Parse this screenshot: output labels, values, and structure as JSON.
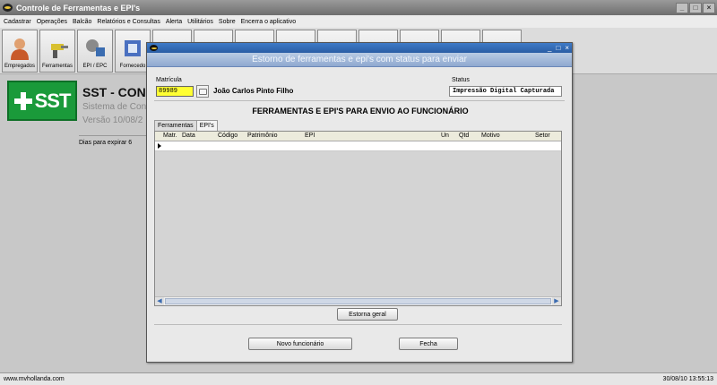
{
  "window": {
    "title": "Controle de Ferramentas e EPI's",
    "controls": {
      "minimize": "_",
      "maximize": "□",
      "close": "×"
    }
  },
  "menu": [
    "Cadastrar",
    "Operações",
    "Balcão",
    "Relatórios e Consultas",
    "Alerta",
    "Utilitários",
    "Sobre",
    "Encerra o aplicativo"
  ],
  "toolbar": {
    "empregados": "Empregados",
    "ferramentas": "Ferramentas",
    "epi_epc": "EPI / EPC",
    "fornecedores": "Fornecedo"
  },
  "background": {
    "logo_text": "SST",
    "app_title": "SST - CONS",
    "app_subtitle": "Sistema de Con",
    "version": "Versão 10/08/2",
    "expiry": "Dias para expirar 6"
  },
  "dialog": {
    "banner": "Estorno de ferramentas e epi's com status para enviar",
    "controls": {
      "minimize": "_",
      "maximize": "□",
      "close": "×"
    },
    "matricula_label": "Matrícula",
    "matricula_value": "89989",
    "employee_name": "João Carlos Pinto Filho",
    "status_label": "Status",
    "status_value": "Impressão Digital Capturada",
    "section_heading": "FERRAMENTAS E EPI'S PARA ENVIO AO FUNCIONÁRIO",
    "tabs": [
      "Ferramentas",
      "EPI's"
    ],
    "grid_columns": {
      "matr": "Matr.",
      "data": "Data",
      "codigo": "Código",
      "patrimonio": "Patrimônio",
      "epi": "EPI",
      "un": "Un",
      "qtd": "Qtd",
      "motivo": "Motivo",
      "setor": "Setor"
    },
    "scroll_left": "◀",
    "scroll_right": "▶",
    "estorna_geral": "Estorna geral",
    "novo_funcionario": "Novo funcionário",
    "fecha": "Fecha"
  },
  "statusbar": {
    "left": "www.mvhollanda.com",
    "right": "30/08/10 13:55:13"
  }
}
